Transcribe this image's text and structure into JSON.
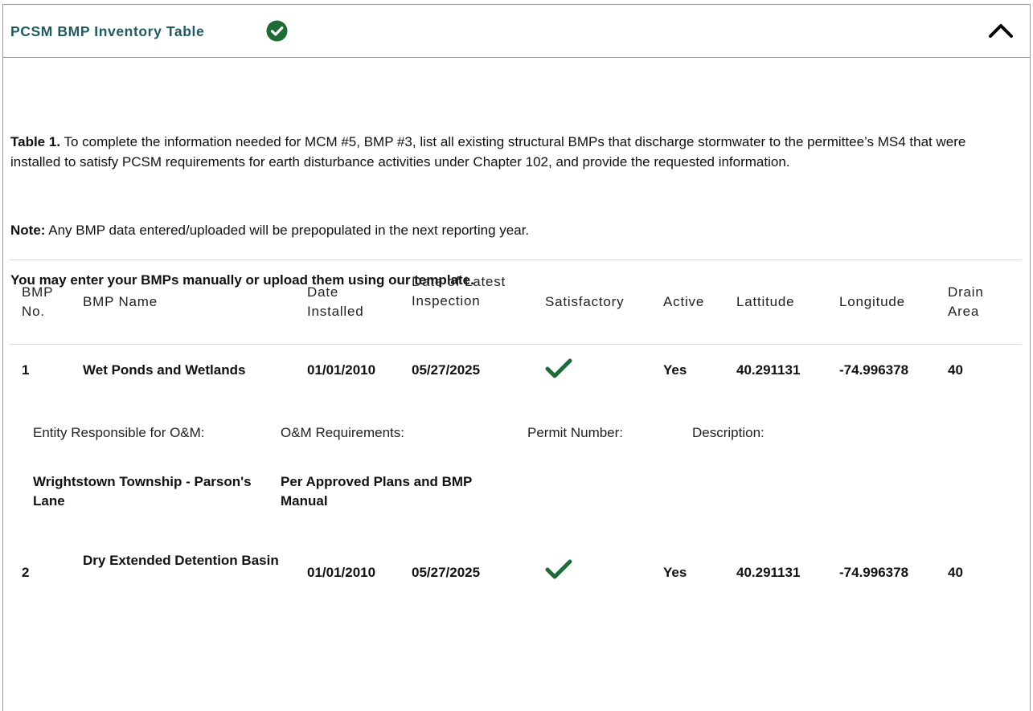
{
  "panel": {
    "title": "PCSM BMP Inventory Table",
    "status_icon": "check-circle-icon",
    "status_color": "#1e6b37",
    "collapse_icon": "chevron-up-icon"
  },
  "intro": {
    "table_ref_label": "Table 1.",
    "table_ref_text": " To complete the information needed for MCM #5, BMP #3, list all existing structural BMPs that discharge stormwater to the permittee’s MS4 that were installed to satisfy PCSM requirements for earth disturbance activities under Chapter 102, and provide the requested information.",
    "note_label": "Note:",
    "note_text": " Any BMP data entered/uploaded will be prepopulated in the next reporting year.",
    "upload_prompt": "You may enter your BMPs manually or upload them using our template."
  },
  "table": {
    "headers": {
      "bmp_no": "BMP No.",
      "bmp_name": "BMP Name",
      "date_installed": "Date Installed",
      "date_inspection": "Date of Latest Inspection",
      "satisfactory": "Satisfactory",
      "active": "Active",
      "latitude": "Lattitude",
      "longitude": "Longitude",
      "drain_area": "Drain Area"
    },
    "rows": [
      {
        "no": "1",
        "name": "Wet Ponds and Wetlands",
        "date_installed": "01/01/2010",
        "date_inspection": "05/27/2025",
        "satisfactory_icon": "checkmark-icon",
        "active": "Yes",
        "latitude": "40.291131",
        "longitude": "-74.996378",
        "drain_area": "40",
        "details": {
          "entity_label": "Entity Responsible for O&M:",
          "om_label": "O&M Requirements:",
          "permit_label": "Permit Number:",
          "description_label": "Description:",
          "entity_value": "Wrightstown Township - Parson's Lane",
          "om_value": "Per Approved Plans and BMP Manual",
          "permit_value": "",
          "description_value": ""
        }
      },
      {
        "no": "2",
        "name": "Dry Extended Detention Basin",
        "date_installed": "01/01/2010",
        "date_inspection": "05/27/2025",
        "satisfactory_icon": "checkmark-icon",
        "active": "Yes",
        "latitude": "40.291131",
        "longitude": "-74.996378",
        "drain_area": "40"
      }
    ]
  },
  "colors": {
    "title": "#1f5b5e",
    "check_green": "#1e6b37",
    "border": "#9a9a9a",
    "rule": "#dcdcdc"
  }
}
